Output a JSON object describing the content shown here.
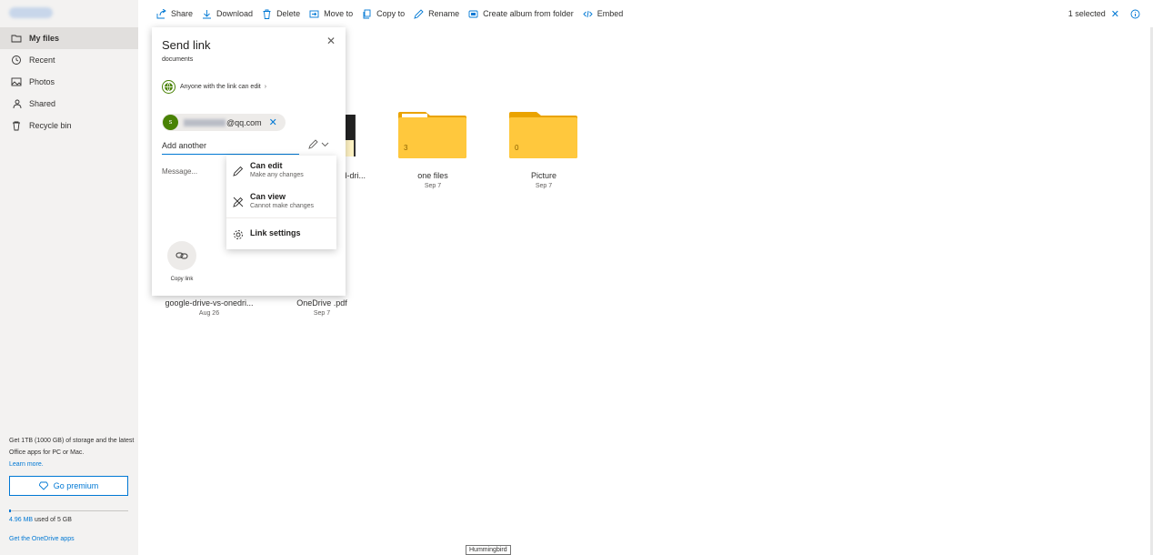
{
  "sidebar": {
    "items": [
      {
        "label": "My files",
        "icon": "folder-icon"
      },
      {
        "label": "Recent",
        "icon": "clock-icon"
      },
      {
        "label": "Photos",
        "icon": "photo-icon"
      },
      {
        "label": "Shared",
        "icon": "people-icon"
      },
      {
        "label": "Recycle bin",
        "icon": "trash-icon"
      }
    ],
    "promo_text": "Get 1TB (1000 GB) of storage and the latest Office apps for PC or Mac.",
    "learn_more": "Learn more.",
    "premium_label": "Go premium",
    "usage_amount": "4.96 MB",
    "usage_rest": "used of 5 GB",
    "get_apps": "Get the OneDrive apps"
  },
  "toolbar": {
    "share": "Share",
    "download": "Download",
    "delete": "Delete",
    "move_to": "Move to",
    "copy_to": "Copy to",
    "rename": "Rename",
    "create_album": "Create album from folder",
    "embed": "Embed",
    "selected": "1 selected"
  },
  "files": [
    {
      "name": "one files",
      "date": "Sep 7",
      "count": "3"
    },
    {
      "name": "Picture",
      "date": "Sep 7",
      "count": "0"
    },
    {
      "name": "google-drive-vs-onedri...",
      "date": "Aug 26"
    },
    {
      "name": "OneDrive .pdf",
      "date": "Sep 7"
    },
    {
      "name": "d-dri..."
    }
  ],
  "dialog": {
    "title": "Send link",
    "subtitle": "documents",
    "permission": "Anyone with the link can edit",
    "recipient_initial": "s",
    "recipient_suffix": "@qq.com",
    "add_placeholder": "Add another",
    "message_placeholder": "Message...",
    "copy_link": "Copy link"
  },
  "menu": {
    "can_edit": "Can edit",
    "can_edit_desc": "Make any changes",
    "can_view": "Can view",
    "can_view_desc": "Cannot make changes",
    "link_settings": "Link settings"
  },
  "tooltip": "Hummingbird",
  "colors": {
    "accent": "#0078d4",
    "folder": "#ffc83d",
    "folder_tab": "#eaa300",
    "avatar": "#498205"
  }
}
